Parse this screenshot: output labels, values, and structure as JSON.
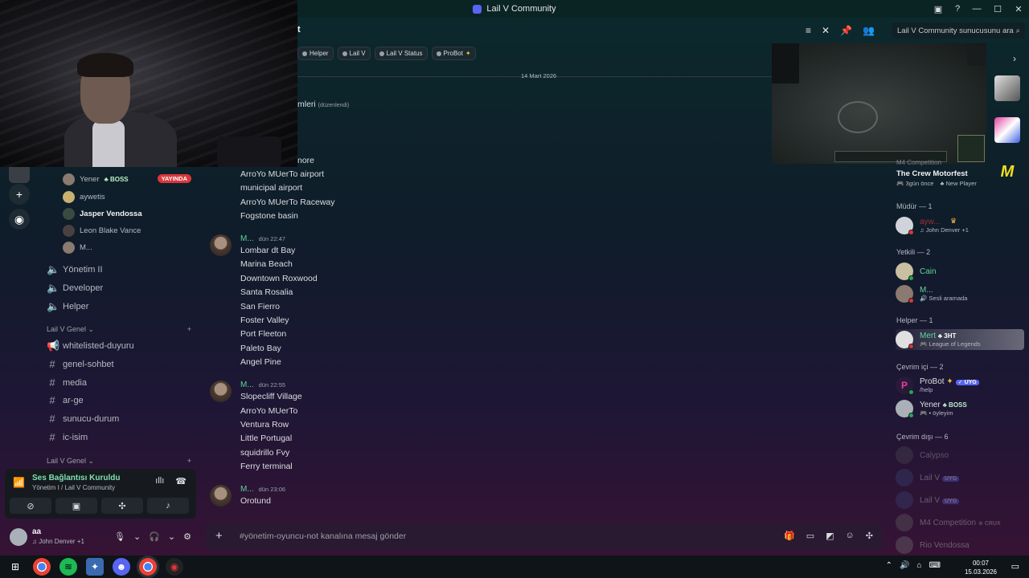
{
  "window": {
    "title": "Lail V Community"
  },
  "header": {
    "channel_partial": "t",
    "search_placeholder": "Lail V Community sunucusunu ara"
  },
  "tags": [
    {
      "label": "Helper"
    },
    {
      "label": "Lail V"
    },
    {
      "label": "Lail V Status"
    },
    {
      "label": "ProBot",
      "suffix": "✦"
    }
  ],
  "date_divider": "14 Mart 2026",
  "first_message": {
    "partial_text": "mleri",
    "edited": "(düzenlendi)",
    "partial_line": "nore"
  },
  "messages": [
    {
      "author": "M...",
      "time": "",
      "lines": [
        "ArroYo MUerTo airport",
        "municipal airport",
        "ArroYo MUerTo Raceway",
        "Fogstone basin"
      ]
    },
    {
      "author": "M...",
      "time": "dün 22:47",
      "lines": [
        "Lombar dt Bay",
        "Marina Beach",
        "Downtown Roxwood",
        "Santa Rosalia",
        "San Fierro",
        "Foster Valley",
        "Port Fleeton",
        "Paleto Bay",
        "Angel Pine"
      ]
    },
    {
      "author": "M...",
      "time": "dün 22:55",
      "lines": [
        "Slopecliff Village",
        "ArroYo MUerTo",
        "Ventura Row",
        "Little Portugal",
        "squidrillo Fvy",
        "Ferry terminal"
      ]
    },
    {
      "author": "M...",
      "time": "dün 23:06",
      "lines": [
        "Orotund"
      ]
    }
  ],
  "input": {
    "placeholder": "#yönetim-oyuncu-not kanalına mesaj gönder"
  },
  "sidebar": {
    "voice_users": [
      {
        "name": "Yener",
        "badge": "BOSS",
        "live": "YAYINDA"
      },
      {
        "name": "aywetis"
      },
      {
        "name": "Jasper Vendossa"
      },
      {
        "name": "Leon Blake Vance"
      },
      {
        "name": "M..."
      }
    ],
    "voice_channels": [
      "Yönetim II",
      "Developer",
      "Helper"
    ],
    "category1": "Lail V Genel",
    "text_channels": [
      "whitelisted-duyuru",
      "genel-sohbet",
      "media",
      "ar-ge",
      "sunucu-durum",
      "ic-isim"
    ],
    "category2": "Lail V Genel"
  },
  "voice_panel": {
    "status": "Ses Bağlantısı Kuruldu",
    "sub": "Yönetim I / Lail V Community"
  },
  "user_panel": {
    "name": "aa",
    "status": "John Denver +1"
  },
  "game_panel": {
    "partial": "M4 Competition",
    "game": "The Crew Motorfest",
    "ago": "3gün önce",
    "tag": "New Player"
  },
  "members": {
    "cat_mudur": "Müdür — 1",
    "cat_yetkili": "Yetkili — 2",
    "cat_helper": "Helper — 1",
    "cat_online": "Çevrim içi — 2",
    "cat_offline": "Çevrim dışı — 6",
    "mudur": [
      {
        "name": "ayw...",
        "activity": "John Denver +1"
      }
    ],
    "yetkili": [
      {
        "name": "Cain"
      },
      {
        "name": "M...",
        "activity": "Sesli aramada"
      }
    ],
    "helper": [
      {
        "name": "Mert",
        "badge": "3HT",
        "activity": "League of Legends"
      }
    ],
    "online": [
      {
        "name": "ProBot",
        "badge": "UYG",
        "activity": "/help"
      },
      {
        "name": "Yener",
        "badge": "BOSS",
        "activity": "• öyleyim"
      }
    ],
    "offline": [
      {
        "name": "Calypso"
      },
      {
        "name": "Lail V",
        "badge": "UYG"
      },
      {
        "name": "Lail V",
        "badge": "UYG"
      },
      {
        "name": "M4 Competition",
        "badge": "CRUX"
      },
      {
        "name": "Rio Vendossa"
      }
    ]
  },
  "taskbar": {
    "time": "00:07",
    "date": "15.03.2026"
  },
  "colors": {
    "accent": "#5865f2",
    "online": "#23a55a",
    "live": "#da373c",
    "author": "#5cd69a"
  }
}
